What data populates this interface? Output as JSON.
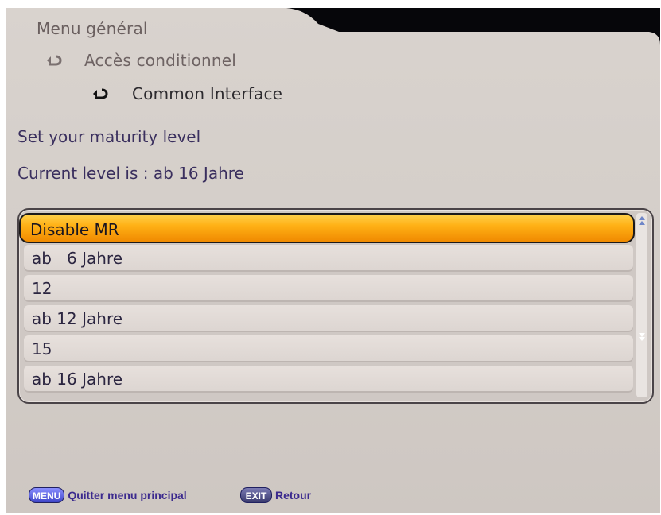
{
  "breadcrumb": {
    "level1": "Menu général",
    "level2": "Accès conditionnel",
    "level3": "Common Interface"
  },
  "heading": {
    "prompt": "Set your maturity level",
    "current": "Current level is : ab 16 Jahre"
  },
  "maturity_list": {
    "items": [
      {
        "label": "Disable MR",
        "selected": true
      },
      {
        "label": "ab   6 Jahre",
        "selected": false
      },
      {
        "label": "12",
        "selected": false
      },
      {
        "label": "ab 12 Jahre",
        "selected": false
      },
      {
        "label": "15",
        "selected": false
      },
      {
        "label": "ab 16 Jahre",
        "selected": false
      }
    ]
  },
  "footer": {
    "menu_key": "MENU",
    "menu_label": "Quitter menu principal",
    "exit_key": "EXIT",
    "exit_label": "Retour"
  },
  "colors": {
    "selection": "#ffb116",
    "text_primary": "#3a2f5e",
    "panel": "#d6d0cb"
  },
  "icons": {
    "breadcrumb_arrow": "return-arrow-icon",
    "scroll_up": "scroll-up-arrow-icon",
    "scroll_down": "scroll-down-arrow-icon"
  }
}
